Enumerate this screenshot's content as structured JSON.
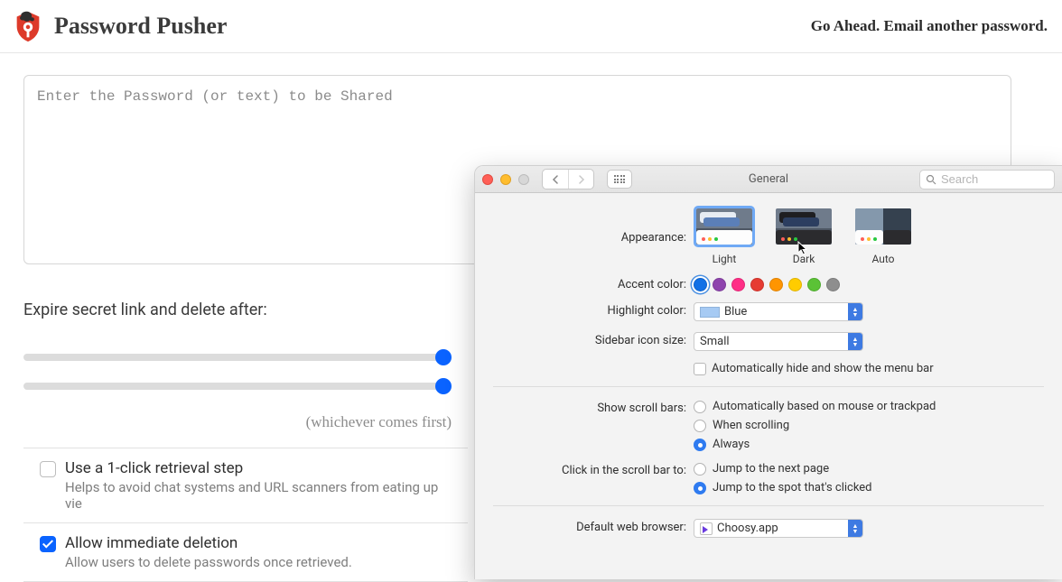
{
  "pp": {
    "title": "Password Pusher",
    "tagline": "Go Ahead.  Email another password.",
    "textarea_placeholder": "Enter the Password (or text) to be Shared",
    "expire_label": "Expire secret link and delete after:",
    "whichever": "(whichever comes first)",
    "option1_title": "Use a 1-click retrieval step",
    "option1_sub": "Helps to avoid chat systems and URL scanners from eating up vie",
    "option2_title": "Allow immediate deletion",
    "option2_sub": "Allow users to delete passwords once retrieved."
  },
  "mac": {
    "title": "General",
    "search_placeholder": "Search",
    "labels": {
      "appearance": "Appearance:",
      "accent": "Accent color:",
      "highlight": "Highlight color:",
      "sidebar": "Sidebar icon size:",
      "auto_hide": "Automatically hide and show the menu bar",
      "scroll": "Show scroll bars:",
      "click_scroll": "Click in the scroll bar to:",
      "default_browser": "Default web browser:"
    },
    "appearance": {
      "light": "Light",
      "dark": "Dark",
      "auto": "Auto"
    },
    "accent_colors": [
      "#1070e6",
      "#8e44ad",
      "#ff2e86",
      "#e63b32",
      "#ff9500",
      "#ffcc00",
      "#5bc236",
      "#8e8e8e"
    ],
    "highlight_value": "Blue",
    "sidebar_value": "Small",
    "scroll_opts": {
      "auto": "Automatically based on mouse or trackpad",
      "when": "When scrolling",
      "always": "Always"
    },
    "click_opts": {
      "next": "Jump to the next page",
      "spot": "Jump to the spot that's clicked"
    },
    "browser_value": "Choosy.app"
  }
}
